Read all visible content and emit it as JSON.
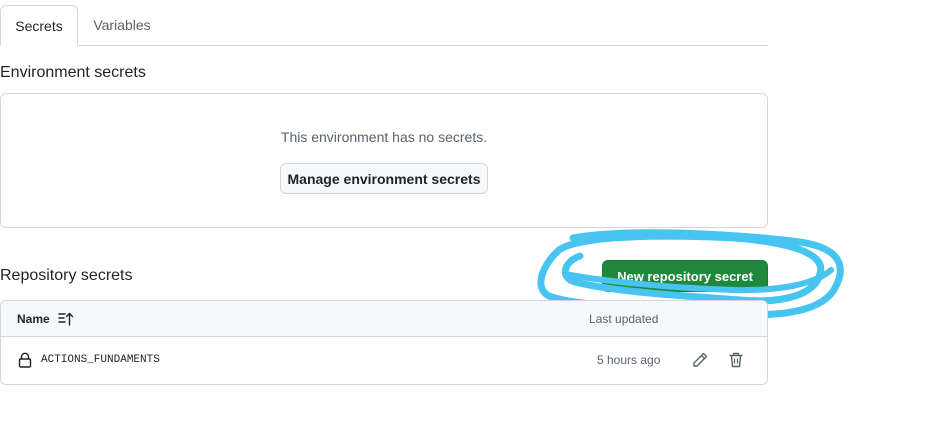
{
  "tabs": [
    {
      "label": "Secrets",
      "active": true
    },
    {
      "label": "Variables",
      "active": false
    }
  ],
  "environment": {
    "heading": "Environment secrets",
    "empty_text": "This environment has no secrets.",
    "manage_button": "Manage environment secrets"
  },
  "repository": {
    "heading": "Repository secrets",
    "new_button": "New repository secret",
    "columns": {
      "name": "Name",
      "updated": "Last updated"
    },
    "rows": [
      {
        "name": "ACTIONS_FUNDAMENTS",
        "updated": "5 hours ago"
      }
    ]
  },
  "colors": {
    "primary_button": "#1f883d",
    "annotation_highlight": "#47c4ef",
    "border": "#d0d7de"
  },
  "icons": [
    "sort-ascending-icon",
    "lock-icon",
    "pencil-icon",
    "trash-icon"
  ]
}
